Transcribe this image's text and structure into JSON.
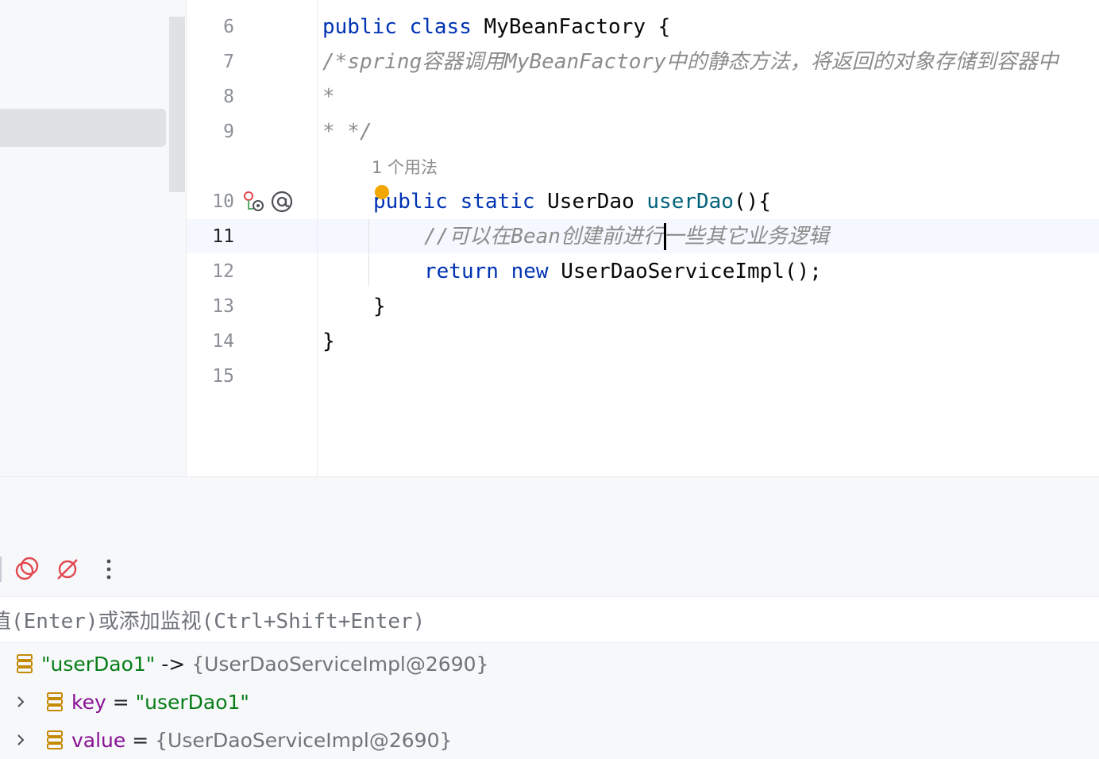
{
  "editor": {
    "line_numbers": [
      "6",
      "7",
      "8",
      "9",
      "10",
      "11",
      "12",
      "13",
      "14",
      "15"
    ],
    "active_line": "11",
    "lines": {
      "l6": {
        "kw1": "public",
        "kw2": "class",
        "name": "MyBeanFactory",
        "rest": "{"
      },
      "l7": {
        "comment": "/*spring容器调用MyBeanFactory中的静态方法，将返回的对象存储到容器中"
      },
      "l8": {
        "comment": "*"
      },
      "l9": {
        "comment": "* */"
      },
      "usage_hint": "1 个用法",
      "l10": {
        "kw1": "public",
        "kw2": "static",
        "type": "UserDao",
        "method": "userDao",
        "rest": "(){"
      },
      "l11": {
        "comment": "//可以在Bean创建前进行一些其它业务逻辑"
      },
      "l12": {
        "kw1": "return",
        "kw2": "new",
        "rest": "UserDaoServiceImpl();"
      },
      "l13": {
        "text": "}"
      },
      "l14": {
        "text": "}"
      }
    }
  },
  "debugger": {
    "evaluate_placeholder": "值(Enter)或添加监视(Ctrl+Shift+Enter)",
    "variables": [
      {
        "name": "\"userDao1\"",
        "arrow": "->",
        "value": "{UserDaoServiceImpl@2690}"
      },
      {
        "name": "key",
        "eq": "=",
        "value": "\"userDao1\""
      },
      {
        "name": "value",
        "eq": "=",
        "value": "{UserDaoServiceImpl@2690}"
      }
    ]
  },
  "colors": {
    "keyword": "#0033b3",
    "method": "#00627a",
    "comment": "#8c8c8c",
    "string": "#067d17",
    "mute_icon": "#e0474f",
    "field_icon": "#c58a06"
  },
  "icons": [
    "implementation-gutter-icon",
    "annotation-at-icon",
    "intention-bulb-icon",
    "view-breakpoints-icon",
    "mute-breakpoints-icon",
    "more-vertical-icon",
    "expand-chevron-icon",
    "field-icon"
  ]
}
